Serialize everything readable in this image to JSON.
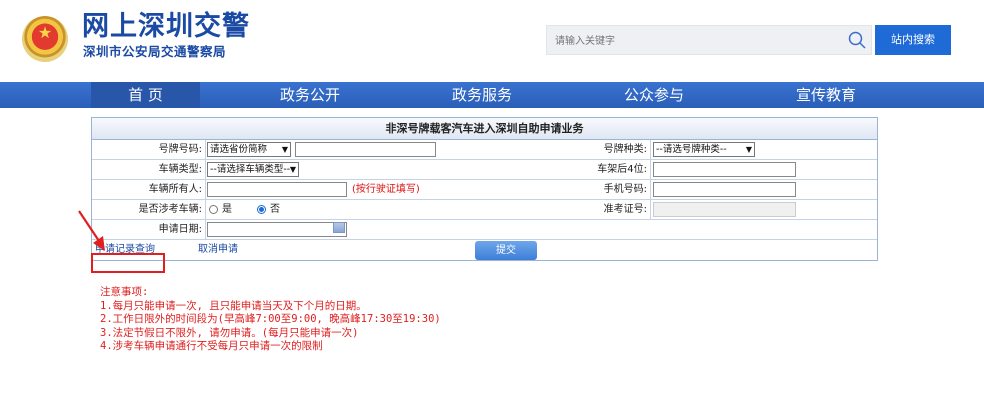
{
  "header": {
    "title": "网上深圳交警",
    "subtitle": "深圳市公安局交通警察局",
    "search_placeholder": "请输入关键字",
    "search_button": "站内搜索"
  },
  "nav": [
    {
      "label": "首 页",
      "active": true
    },
    {
      "label": "政务公开"
    },
    {
      "label": "政务服务"
    },
    {
      "label": "公众参与"
    },
    {
      "label": "宣传教育"
    }
  ],
  "form": {
    "title": "非深号牌载客汽车进入深圳自助申请业务",
    "plate_number_label": "号牌号码:",
    "plate_prefix_select": "请选省份简称",
    "plate_type_label": "号牌种类:",
    "plate_type_select": "--请选号牌种类--",
    "vehicle_type_label": "车辆类型:",
    "vehicle_type_select": "--请选择车辆类型--",
    "vin_label": "车架后4位:",
    "owner_label": "车辆所有人:",
    "owner_hint": "(按行驶证填写)",
    "phone_label": "手机号码:",
    "exam_vehicle_label": "是否涉考车辆:",
    "exam_yes": "是",
    "exam_no": "否",
    "exam_cert_label": "准考证号:",
    "apply_date_label": "申请日期:",
    "record_query_link": "申请记录查询",
    "cancel_link": "取消申请",
    "submit_button": "提交"
  },
  "notes": {
    "heading": "注意事项:",
    "items": [
      "1.每月只能申请一次, 且只能申请当天及下个月的日期。",
      "2.工作日限外的时间段为(早高峰7:00至9:00, 晚高峰17:30至19:30)",
      "3.法定节假日不限外, 请勿申请。(每月只能申请一次)",
      "4.涉考车辆申请通行不受每月只申请一次的限制"
    ]
  },
  "colors": {
    "brand_blue": "#1a4aa3",
    "nav_blue": "#2a5fb8",
    "accent_blue": "#1e6ad6",
    "annotation_red": "#e02020"
  }
}
